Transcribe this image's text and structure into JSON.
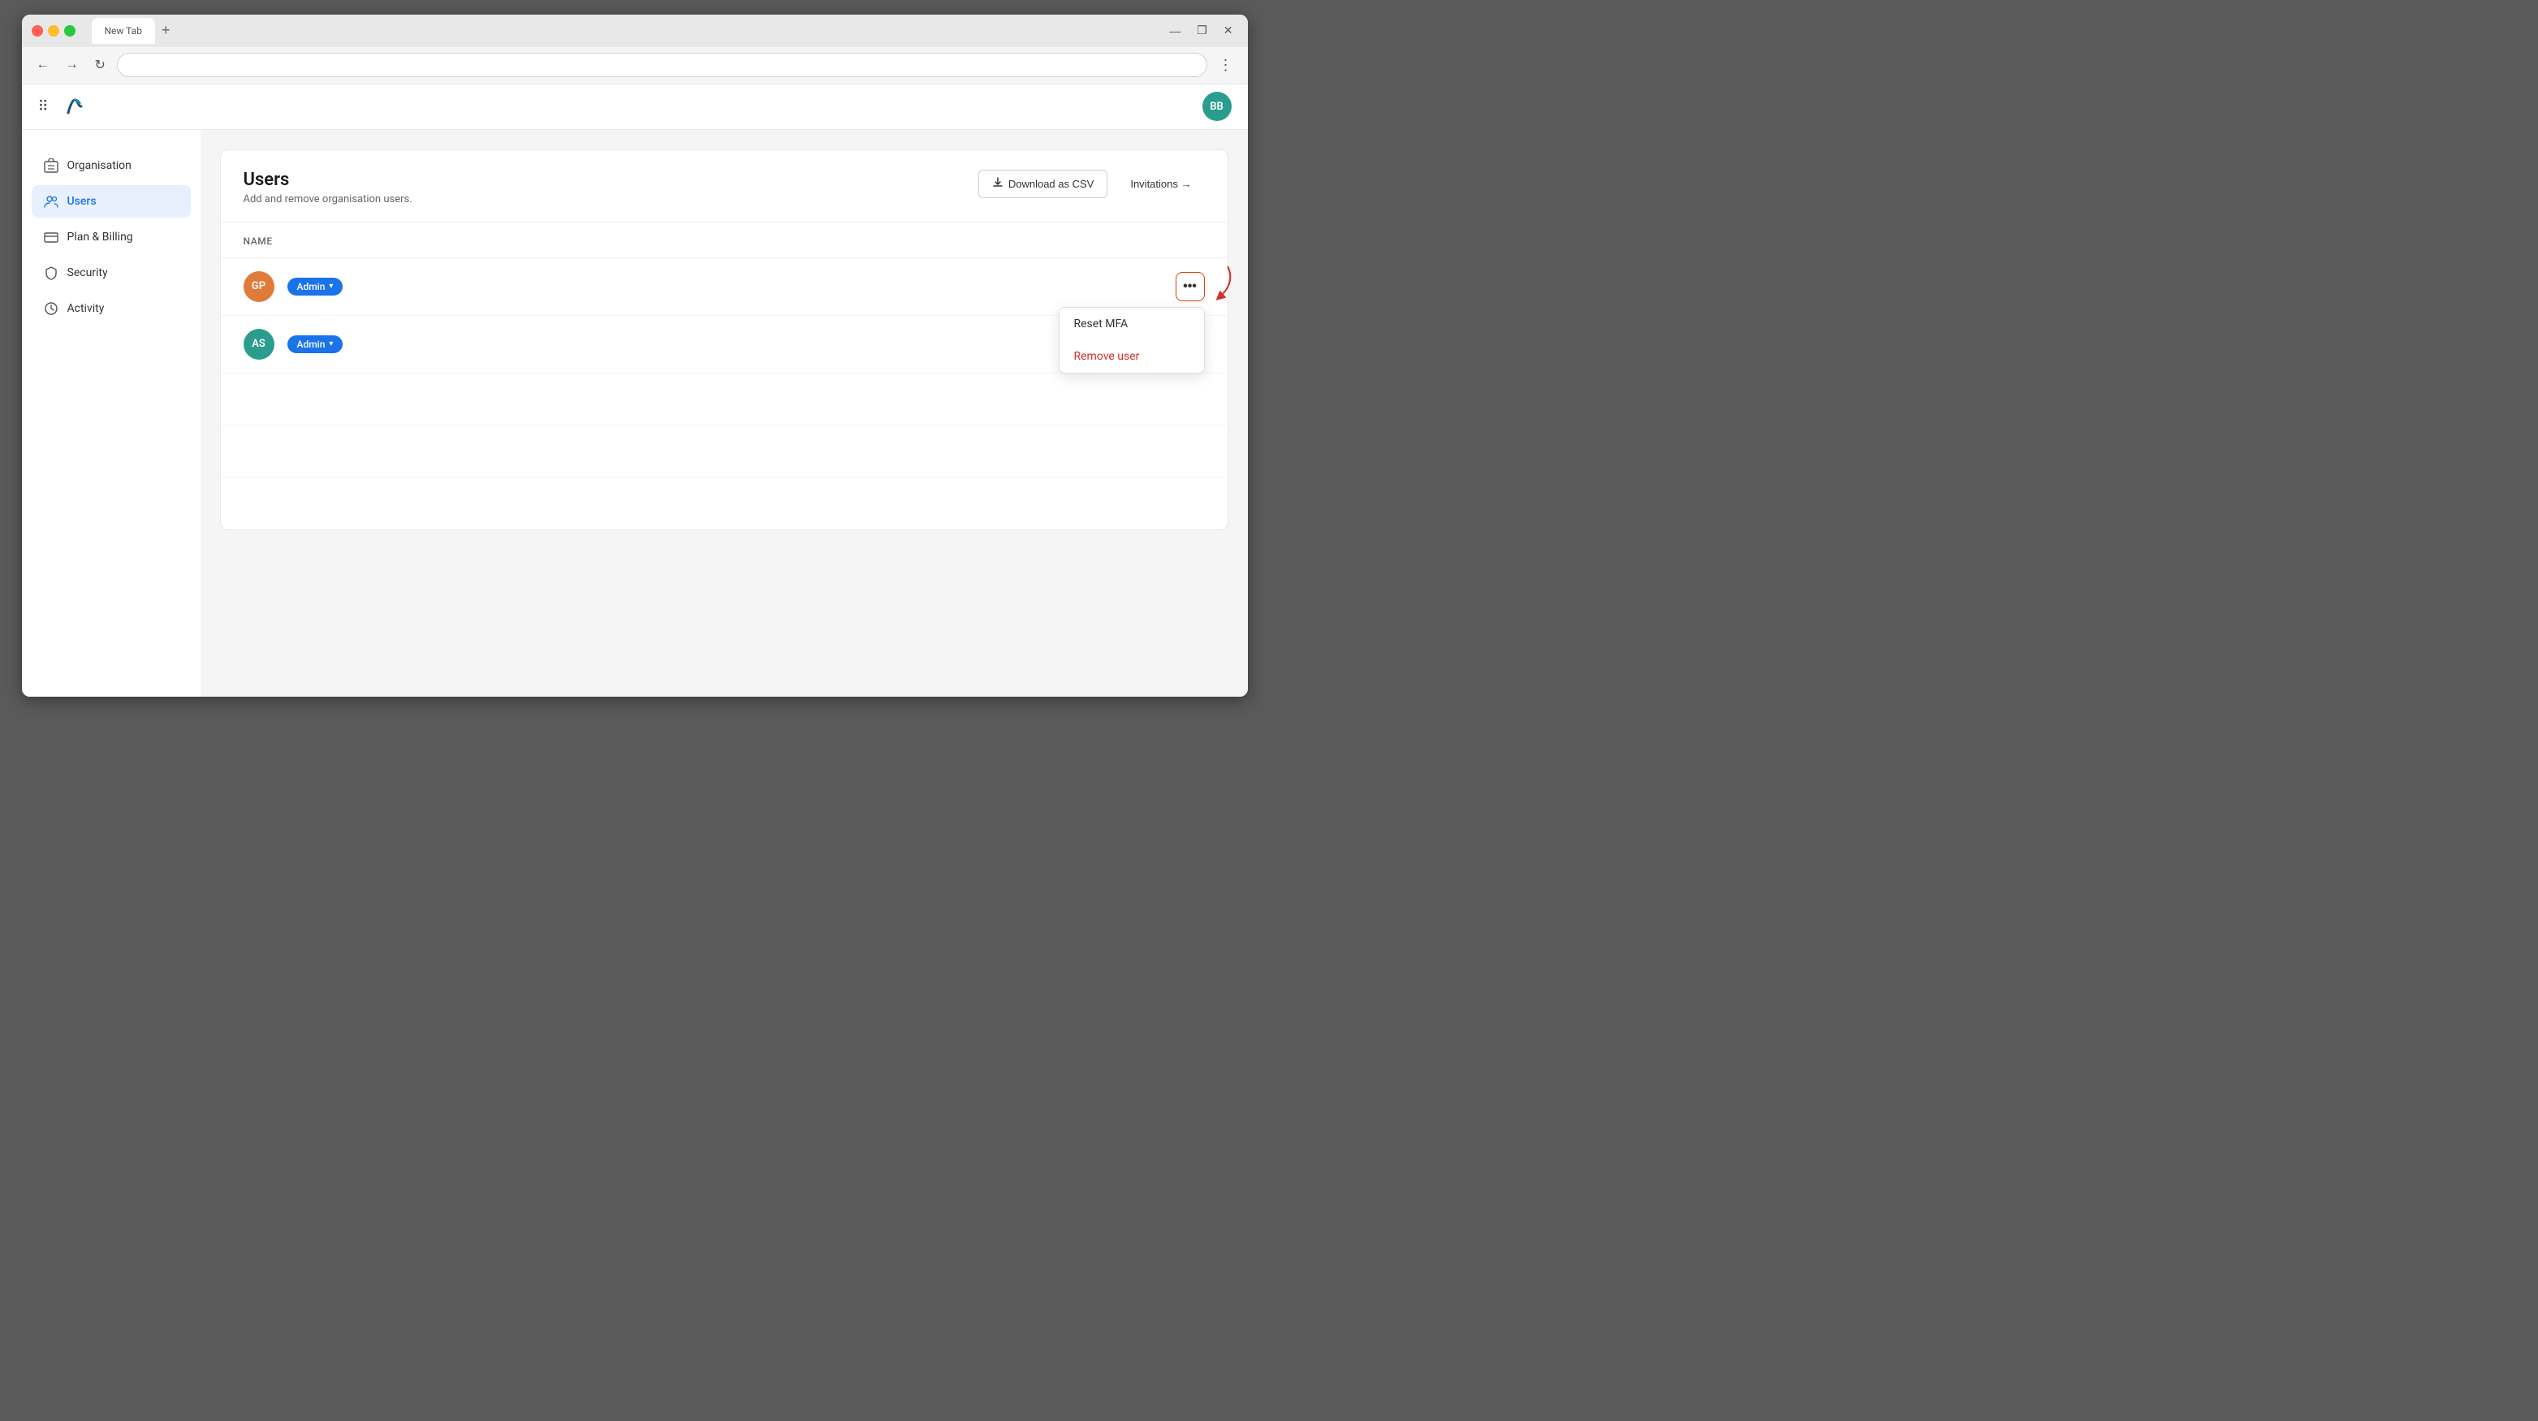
{
  "browser": {
    "tab_label": "",
    "new_tab_label": "+",
    "url": "",
    "back_title": "Back",
    "forward_title": "Forward",
    "refresh_title": "Refresh",
    "more_title": "More"
  },
  "header": {
    "grid_icon": "⠿",
    "avatar_initials": "BB"
  },
  "sidebar": {
    "items": [
      {
        "id": "organisation",
        "label": "Organisation",
        "icon": "🏢"
      },
      {
        "id": "users",
        "label": "Users",
        "icon": "👥",
        "active": true
      },
      {
        "id": "plan-billing",
        "label": "Plan & Billing",
        "icon": "💳"
      },
      {
        "id": "security",
        "label": "Security",
        "icon": "🛡️"
      },
      {
        "id": "activity",
        "label": "Activity",
        "icon": "🕐"
      }
    ]
  },
  "page": {
    "title": "Users",
    "subtitle": "Add and remove organisation users.",
    "download_csv_label": "Download as CSV",
    "invitations_label": "Invitations →",
    "table_col_name": "Name",
    "users": [
      {
        "initials": "GP",
        "color": "orange",
        "role": "Admin"
      },
      {
        "initials": "AS",
        "color": "teal",
        "role": "Admin"
      }
    ],
    "dropdown": {
      "reset_mfa": "Reset MFA",
      "remove_user": "Remove user"
    }
  }
}
